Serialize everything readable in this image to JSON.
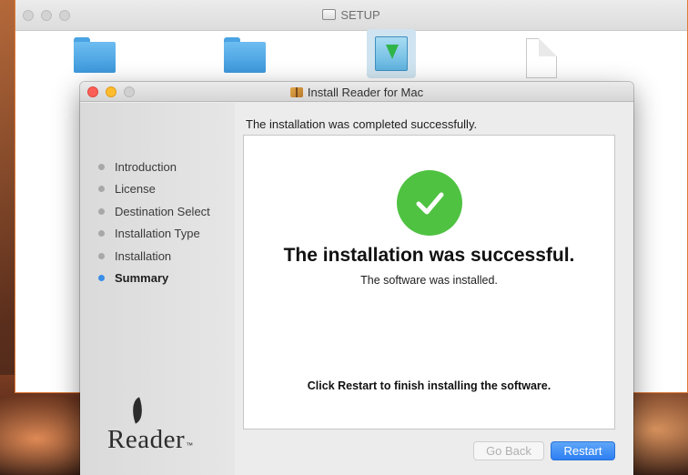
{
  "finder": {
    "title": "SETUP"
  },
  "installer": {
    "title": "Install Reader for Mac",
    "header_message": "The installation was completed successfully.",
    "steps": [
      {
        "label": "Introduction",
        "active": false
      },
      {
        "label": "License",
        "active": false
      },
      {
        "label": "Destination Select",
        "active": false
      },
      {
        "label": "Installation Type",
        "active": false
      },
      {
        "label": "Installation",
        "active": false
      },
      {
        "label": "Summary",
        "active": true
      }
    ],
    "success_title": "The installation was successful.",
    "success_subtitle": "The software was installed.",
    "restart_hint": "Click Restart to finish installing the software.",
    "brand_name": "Reader",
    "brand_tm": "™",
    "buttons": {
      "back_label": "Go Back",
      "restart_label": "Restart"
    }
  },
  "icons": {
    "success": "checkmark-circle-icon",
    "package": "package-icon",
    "disk": "disk-icon"
  },
  "colors": {
    "accent": "#3a8fe8",
    "success_green": "#4fc242",
    "restart_button": "#2d7ff3"
  }
}
